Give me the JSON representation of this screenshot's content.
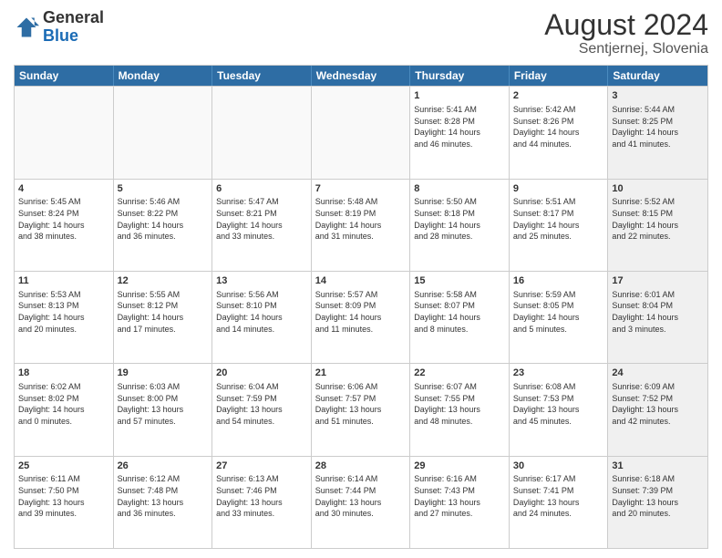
{
  "header": {
    "logo": {
      "line1": "General",
      "line2": "Blue"
    },
    "title": "August 2024",
    "subtitle": "Sentjernej, Slovenia"
  },
  "days_of_week": [
    "Sunday",
    "Monday",
    "Tuesday",
    "Wednesday",
    "Thursday",
    "Friday",
    "Saturday"
  ],
  "weeks": [
    [
      {
        "day": "",
        "content": "",
        "empty": true
      },
      {
        "day": "",
        "content": "",
        "empty": true
      },
      {
        "day": "",
        "content": "",
        "empty": true
      },
      {
        "day": "",
        "content": "",
        "empty": true
      },
      {
        "day": "1",
        "content": "Sunrise: 5:41 AM\nSunset: 8:28 PM\nDaylight: 14 hours\nand 46 minutes.",
        "empty": false
      },
      {
        "day": "2",
        "content": "Sunrise: 5:42 AM\nSunset: 8:26 PM\nDaylight: 14 hours\nand 44 minutes.",
        "empty": false
      },
      {
        "day": "3",
        "content": "Sunrise: 5:44 AM\nSunset: 8:25 PM\nDaylight: 14 hours\nand 41 minutes.",
        "empty": false,
        "shaded": true
      }
    ],
    [
      {
        "day": "4",
        "content": "Sunrise: 5:45 AM\nSunset: 8:24 PM\nDaylight: 14 hours\nand 38 minutes.",
        "empty": false
      },
      {
        "day": "5",
        "content": "Sunrise: 5:46 AM\nSunset: 8:22 PM\nDaylight: 14 hours\nand 36 minutes.",
        "empty": false
      },
      {
        "day": "6",
        "content": "Sunrise: 5:47 AM\nSunset: 8:21 PM\nDaylight: 14 hours\nand 33 minutes.",
        "empty": false
      },
      {
        "day": "7",
        "content": "Sunrise: 5:48 AM\nSunset: 8:19 PM\nDaylight: 14 hours\nand 31 minutes.",
        "empty": false
      },
      {
        "day": "8",
        "content": "Sunrise: 5:50 AM\nSunset: 8:18 PM\nDaylight: 14 hours\nand 28 minutes.",
        "empty": false
      },
      {
        "day": "9",
        "content": "Sunrise: 5:51 AM\nSunset: 8:17 PM\nDaylight: 14 hours\nand 25 minutes.",
        "empty": false
      },
      {
        "day": "10",
        "content": "Sunrise: 5:52 AM\nSunset: 8:15 PM\nDaylight: 14 hours\nand 22 minutes.",
        "empty": false,
        "shaded": true
      }
    ],
    [
      {
        "day": "11",
        "content": "Sunrise: 5:53 AM\nSunset: 8:13 PM\nDaylight: 14 hours\nand 20 minutes.",
        "empty": false
      },
      {
        "day": "12",
        "content": "Sunrise: 5:55 AM\nSunset: 8:12 PM\nDaylight: 14 hours\nand 17 minutes.",
        "empty": false
      },
      {
        "day": "13",
        "content": "Sunrise: 5:56 AM\nSunset: 8:10 PM\nDaylight: 14 hours\nand 14 minutes.",
        "empty": false
      },
      {
        "day": "14",
        "content": "Sunrise: 5:57 AM\nSunset: 8:09 PM\nDaylight: 14 hours\nand 11 minutes.",
        "empty": false
      },
      {
        "day": "15",
        "content": "Sunrise: 5:58 AM\nSunset: 8:07 PM\nDaylight: 14 hours\nand 8 minutes.",
        "empty": false
      },
      {
        "day": "16",
        "content": "Sunrise: 5:59 AM\nSunset: 8:05 PM\nDaylight: 14 hours\nand 5 minutes.",
        "empty": false
      },
      {
        "day": "17",
        "content": "Sunrise: 6:01 AM\nSunset: 8:04 PM\nDaylight: 14 hours\nand 3 minutes.",
        "empty": false,
        "shaded": true
      }
    ],
    [
      {
        "day": "18",
        "content": "Sunrise: 6:02 AM\nSunset: 8:02 PM\nDaylight: 14 hours\nand 0 minutes.",
        "empty": false
      },
      {
        "day": "19",
        "content": "Sunrise: 6:03 AM\nSunset: 8:00 PM\nDaylight: 13 hours\nand 57 minutes.",
        "empty": false
      },
      {
        "day": "20",
        "content": "Sunrise: 6:04 AM\nSunset: 7:59 PM\nDaylight: 13 hours\nand 54 minutes.",
        "empty": false
      },
      {
        "day": "21",
        "content": "Sunrise: 6:06 AM\nSunset: 7:57 PM\nDaylight: 13 hours\nand 51 minutes.",
        "empty": false
      },
      {
        "day": "22",
        "content": "Sunrise: 6:07 AM\nSunset: 7:55 PM\nDaylight: 13 hours\nand 48 minutes.",
        "empty": false
      },
      {
        "day": "23",
        "content": "Sunrise: 6:08 AM\nSunset: 7:53 PM\nDaylight: 13 hours\nand 45 minutes.",
        "empty": false
      },
      {
        "day": "24",
        "content": "Sunrise: 6:09 AM\nSunset: 7:52 PM\nDaylight: 13 hours\nand 42 minutes.",
        "empty": false,
        "shaded": true
      }
    ],
    [
      {
        "day": "25",
        "content": "Sunrise: 6:11 AM\nSunset: 7:50 PM\nDaylight: 13 hours\nand 39 minutes.",
        "empty": false
      },
      {
        "day": "26",
        "content": "Sunrise: 6:12 AM\nSunset: 7:48 PM\nDaylight: 13 hours\nand 36 minutes.",
        "empty": false
      },
      {
        "day": "27",
        "content": "Sunrise: 6:13 AM\nSunset: 7:46 PM\nDaylight: 13 hours\nand 33 minutes.",
        "empty": false
      },
      {
        "day": "28",
        "content": "Sunrise: 6:14 AM\nSunset: 7:44 PM\nDaylight: 13 hours\nand 30 minutes.",
        "empty": false
      },
      {
        "day": "29",
        "content": "Sunrise: 6:16 AM\nSunset: 7:43 PM\nDaylight: 13 hours\nand 27 minutes.",
        "empty": false
      },
      {
        "day": "30",
        "content": "Sunrise: 6:17 AM\nSunset: 7:41 PM\nDaylight: 13 hours\nand 24 minutes.",
        "empty": false
      },
      {
        "day": "31",
        "content": "Sunrise: 6:18 AM\nSunset: 7:39 PM\nDaylight: 13 hours\nand 20 minutes.",
        "empty": false,
        "shaded": true
      }
    ]
  ]
}
